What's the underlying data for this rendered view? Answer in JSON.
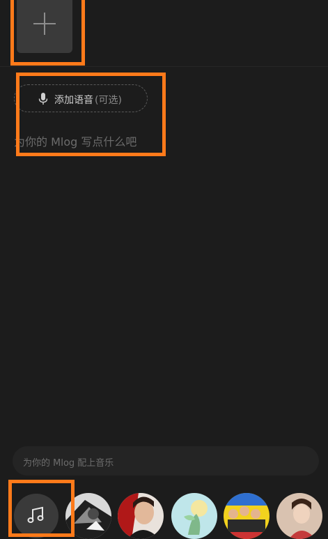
{
  "composer": {
    "add_media_icon": "plus-icon",
    "voice": {
      "icon": "microphone-icon",
      "label": "添加语音",
      "optional": "(可选)"
    },
    "text_placeholder": "为你的 Mlog 写点什么吧"
  },
  "music": {
    "input_placeholder": "为你的 Mlog 配上音乐",
    "button_icon": "music-note-icon",
    "recommended_covers": [
      {
        "name": "album-cover-1"
      },
      {
        "name": "album-cover-2"
      },
      {
        "name": "album-cover-3"
      },
      {
        "name": "album-cover-4"
      },
      {
        "name": "album-cover-5"
      }
    ]
  },
  "colors": {
    "background": "#1c1c1c",
    "highlight": "#ff7a1a",
    "tile": "#3a3a3a"
  }
}
